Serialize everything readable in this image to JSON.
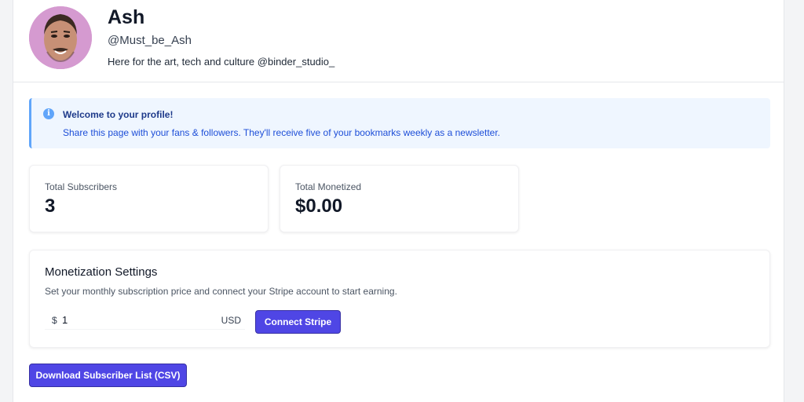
{
  "profile": {
    "name": "Ash",
    "handle": "@Must_be_Ash",
    "bio": "Here for the art, tech and culture @binder_studio_"
  },
  "banner": {
    "icon": "info-icon",
    "icon_glyph": "i",
    "title": "Welcome to your profile!",
    "text": "Share this page with your fans & followers. They'll receive five of your bookmarks weekly as a newsletter."
  },
  "stats": {
    "subscribers": {
      "label": "Total Subscribers",
      "value": "3"
    },
    "monetized": {
      "label": "Total Monetized",
      "value": "$0.00"
    }
  },
  "monetization": {
    "title": "Monetization Settings",
    "description": "Set your monthly subscription price and connect your Stripe account to start earning.",
    "currency_symbol": "$",
    "price_value": "1",
    "currency_code": "USD",
    "connect_label": "Connect Stripe"
  },
  "actions": {
    "download_label": "Download Subscriber List (CSV)"
  },
  "colors": {
    "accent": "#4f46e5",
    "banner_bg": "#eff6ff",
    "banner_border": "#60a5fa",
    "avatar_bg": "#d59ad0"
  }
}
